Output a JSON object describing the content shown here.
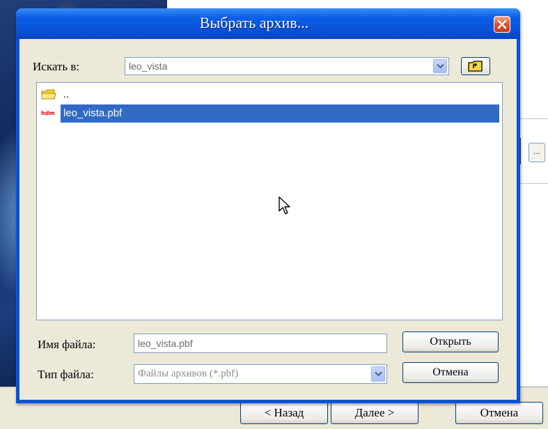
{
  "dialog": {
    "title": "Выбрать архив...",
    "look_in_label": "Искать в:",
    "look_in_value": "leo_vista",
    "files": [
      {
        "name": "..",
        "type": "folder",
        "selected": false
      },
      {
        "name": "leo_vista.pbf",
        "type": "pbf",
        "icon_text": "hdm",
        "selected": true
      }
    ],
    "filename_label": "Имя файла:",
    "filename_value": "leo_vista.pbf",
    "filetype_label": "Тип файла:",
    "filetype_value": "Файлы архивов (*.pbf)",
    "open_button": "Открыть",
    "cancel_button": "Отмена"
  },
  "wizard": {
    "browse_button": "...",
    "back_button": "< Назад",
    "next_button": "Далее >",
    "cancel_button": "Отмена"
  },
  "colors": {
    "titlebar": "#0a52d8",
    "selection": "#316ac5",
    "dialog_face": "#ece9d8"
  }
}
